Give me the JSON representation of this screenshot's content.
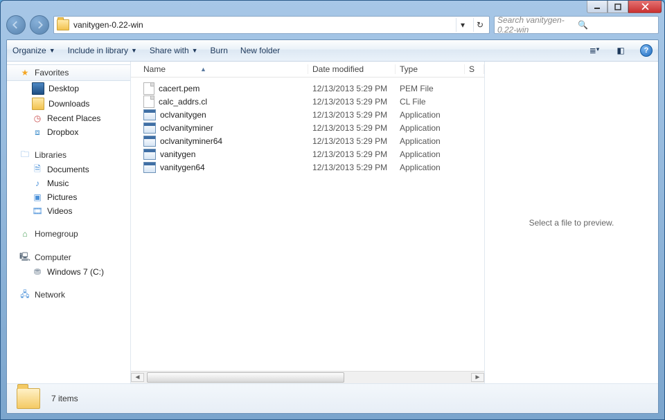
{
  "title": "vanitygen-0.22-win",
  "search_placeholder": "Search vanitygen-0.22-win",
  "toolbar": {
    "organize": "Organize",
    "include": "Include in library",
    "share": "Share with",
    "burn": "Burn",
    "newfolder": "New folder"
  },
  "nav": {
    "favorites": "Favorites",
    "desktop": "Desktop",
    "downloads": "Downloads",
    "recent": "Recent Places",
    "dropbox": "Dropbox",
    "libraries": "Libraries",
    "documents": "Documents",
    "music": "Music",
    "pictures": "Pictures",
    "videos": "Videos",
    "homegroup": "Homegroup",
    "computer": "Computer",
    "drive_c": "Windows 7 (C:)",
    "network": "Network"
  },
  "columns": {
    "name": "Name",
    "date": "Date modified",
    "type": "Type",
    "size": "S"
  },
  "files": [
    {
      "name": "cacert.pem",
      "date": "12/13/2013 5:29 PM",
      "type": "PEM File",
      "icon": "file"
    },
    {
      "name": "calc_addrs.cl",
      "date": "12/13/2013 5:29 PM",
      "type": "CL File",
      "icon": "file"
    },
    {
      "name": "oclvanitygen",
      "date": "12/13/2013 5:29 PM",
      "type": "Application",
      "icon": "app"
    },
    {
      "name": "oclvanityminer",
      "date": "12/13/2013 5:29 PM",
      "type": "Application",
      "icon": "app"
    },
    {
      "name": "oclvanityminer64",
      "date": "12/13/2013 5:29 PM",
      "type": "Application",
      "icon": "app"
    },
    {
      "name": "vanitygen",
      "date": "12/13/2013 5:29 PM",
      "type": "Application",
      "icon": "app"
    },
    {
      "name": "vanitygen64",
      "date": "12/13/2013 5:29 PM",
      "type": "Application",
      "icon": "app"
    }
  ],
  "preview_text": "Select a file to preview.",
  "status_text": "7 items"
}
